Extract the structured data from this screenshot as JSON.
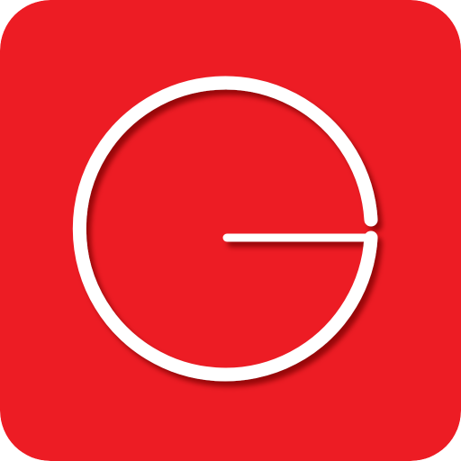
{
  "icon": {
    "name": "clock-logo",
    "background_color": "#ED1C24",
    "symbol_color": "#FFFFFF",
    "shadow_color": "#7A0000"
  }
}
